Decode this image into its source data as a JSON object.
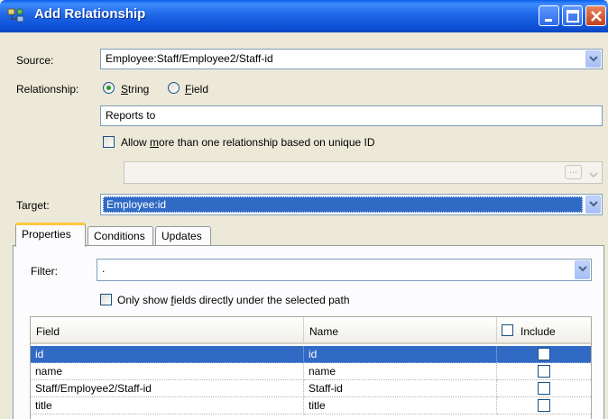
{
  "window": {
    "title": "Add Relationship"
  },
  "source": {
    "label": "Source:",
    "value": "Employee:Staff/Employee2/Staff-id"
  },
  "relationship": {
    "label": "Relationship:",
    "options": [
      {
        "access_key": "S",
        "rest": "tring",
        "selected": true
      },
      {
        "access_key": "F",
        "rest": "ield",
        "selected": false
      }
    ],
    "value": "Reports to"
  },
  "allow_multiple": {
    "prefix": "Allow ",
    "access_key": "m",
    "rest": "ore than one relationship based on unique ID",
    "checked": false
  },
  "unique_id_combo": {
    "value": "",
    "browse_label": "..."
  },
  "target": {
    "label": "Target:",
    "value": "Employee:id"
  },
  "tabs": [
    {
      "label": "Properties",
      "active": true
    },
    {
      "label": "Conditions",
      "active": false
    },
    {
      "label": "Updates",
      "active": false
    }
  ],
  "filter": {
    "label": "Filter:",
    "value": "."
  },
  "only_show": {
    "prefix": "Only show ",
    "access_key": "f",
    "rest": "ields directly under the selected path",
    "checked": false
  },
  "grid": {
    "columns": [
      "Field",
      "Name",
      "Include"
    ],
    "rows": [
      {
        "field": "id",
        "name": "id",
        "include": false,
        "selected": true
      },
      {
        "field": "name",
        "name": "name",
        "include": false,
        "selected": false
      },
      {
        "field": "Staff/Employee2/Staff-id",
        "name": "Staff-id",
        "include": false,
        "selected": false
      },
      {
        "field": "title",
        "name": "title",
        "include": false,
        "selected": false
      }
    ]
  },
  "colors": {
    "title_bar": "#0A5FE8",
    "selection": "#316AC5",
    "active_tab_accent": "#FFC83C",
    "dialog_bg": "#ECE9D8"
  }
}
